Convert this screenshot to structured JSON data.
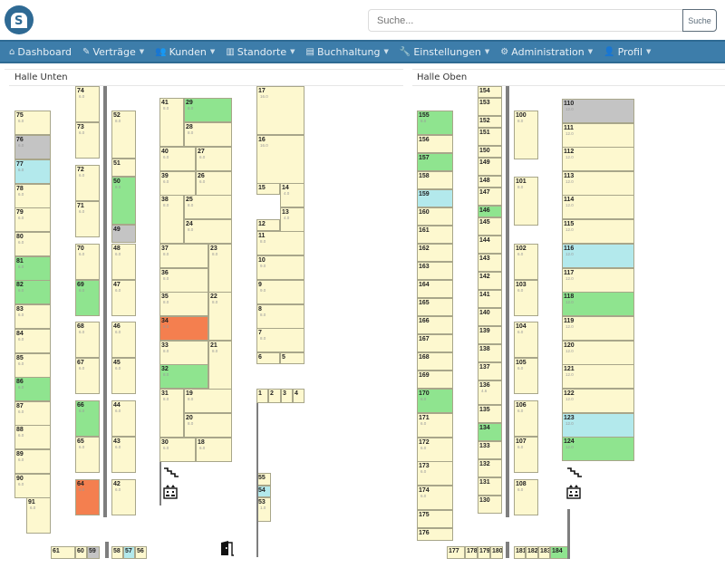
{
  "header": {
    "logo": "storage-logo",
    "search": {
      "placeholder": "Suche...",
      "value": "",
      "button": "Suche"
    }
  },
  "nav": [
    {
      "label": "Dashboard",
      "icon": "home-icon",
      "glyph": "⌂",
      "dropdown": false
    },
    {
      "label": "Verträge",
      "icon": "contract-icon",
      "glyph": "✎",
      "dropdown": true
    },
    {
      "label": "Kunden",
      "icon": "users-icon",
      "glyph": "👥",
      "dropdown": true
    },
    {
      "label": "Standorte",
      "icon": "warehouse-icon",
      "glyph": "▥",
      "dropdown": true
    },
    {
      "label": "Buchhaltung",
      "icon": "document-icon",
      "glyph": "▤",
      "dropdown": true
    },
    {
      "label": "Einstellungen",
      "icon": "wrench-icon",
      "glyph": "🔧",
      "dropdown": true
    },
    {
      "label": "Administration",
      "icon": "gear-icon",
      "glyph": "⚙",
      "dropdown": true
    },
    {
      "label": "Profil",
      "icon": "user-icon",
      "glyph": "👤",
      "dropdown": true
    }
  ],
  "halls": [
    {
      "title": "Halle Unten",
      "units": [
        {
          "id": "74",
          "size": "6.0",
          "status": "free"
        },
        {
          "id": "73",
          "size": "6.0",
          "status": "free"
        },
        {
          "id": "75",
          "size": "6.0",
          "status": "free"
        },
        {
          "id": "76",
          "size": "6.0",
          "status": "blocked"
        },
        {
          "id": "77",
          "size": "6.0",
          "status": "reserved"
        },
        {
          "id": "78",
          "size": "6.0",
          "status": "free"
        },
        {
          "id": "79",
          "size": "6.0",
          "status": "free"
        },
        {
          "id": "80",
          "size": "6.0",
          "status": "free"
        },
        {
          "id": "81",
          "size": "6.0",
          "status": "rented"
        },
        {
          "id": "82",
          "size": "6.0",
          "status": "rented"
        },
        {
          "id": "83",
          "size": "6.0",
          "status": "free"
        },
        {
          "id": "84",
          "size": "6.0",
          "status": "free"
        },
        {
          "id": "85",
          "size": "6.0",
          "status": "free"
        },
        {
          "id": "86",
          "size": "6.0",
          "status": "rented"
        },
        {
          "id": "87",
          "size": "6.0",
          "status": "free"
        },
        {
          "id": "88",
          "size": "6.0",
          "status": "free"
        },
        {
          "id": "89",
          "size": "6.0",
          "status": "free"
        },
        {
          "id": "90",
          "size": "6.0",
          "status": "free"
        },
        {
          "id": "91",
          "size": "6.0",
          "status": "free"
        },
        {
          "id": "72",
          "size": "6.0",
          "status": "free"
        },
        {
          "id": "71",
          "size": "6.0",
          "status": "free"
        },
        {
          "id": "70",
          "size": "6.0",
          "status": "free"
        },
        {
          "id": "69",
          "size": "6.0",
          "status": "rented"
        },
        {
          "id": "68",
          "size": "6.0",
          "status": "free"
        },
        {
          "id": "67",
          "size": "6.0",
          "status": "free"
        },
        {
          "id": "66",
          "size": "6.0",
          "status": "rented"
        },
        {
          "id": "65",
          "size": "6.0",
          "status": "free"
        },
        {
          "id": "64",
          "size": "6.0",
          "status": "overdue"
        },
        {
          "id": "52",
          "size": "8.0",
          "status": "free"
        },
        {
          "id": "51",
          "size": "",
          "status": "free"
        },
        {
          "id": "50",
          "size": "8.0",
          "status": "rented"
        },
        {
          "id": "49",
          "size": "",
          "status": "blocked"
        },
        {
          "id": "48",
          "size": "6.0",
          "status": "free"
        },
        {
          "id": "47",
          "size": "6.0",
          "status": "free"
        },
        {
          "id": "46",
          "size": "6.0",
          "status": "free"
        },
        {
          "id": "45",
          "size": "6.0",
          "status": "free"
        },
        {
          "id": "44",
          "size": "6.0",
          "status": "free"
        },
        {
          "id": "43",
          "size": "6.0",
          "status": "free"
        },
        {
          "id": "42",
          "size": "6.0",
          "status": "free"
        },
        {
          "id": "41",
          "size": "8.0",
          "status": "free"
        },
        {
          "id": "29",
          "size": "8.0",
          "status": "rented"
        },
        {
          "id": "28",
          "size": "8.0",
          "status": "free"
        },
        {
          "id": "40",
          "size": "6.0",
          "status": "free"
        },
        {
          "id": "27",
          "size": "6.0",
          "status": "free"
        },
        {
          "id": "39",
          "size": "6.0",
          "status": "free"
        },
        {
          "id": "26",
          "size": "6.0",
          "status": "free"
        },
        {
          "id": "38",
          "size": "8.0",
          "status": "free"
        },
        {
          "id": "25",
          "size": "8.0",
          "status": "free"
        },
        {
          "id": "24",
          "size": "8.0",
          "status": "free"
        },
        {
          "id": "37",
          "size": "8.0",
          "status": "free"
        },
        {
          "id": "23",
          "size": "8.0",
          "status": "free"
        },
        {
          "id": "36",
          "size": "8.0",
          "status": "free"
        },
        {
          "id": "35",
          "size": "8.0",
          "status": "free"
        },
        {
          "id": "22",
          "size": "8.0",
          "status": "free"
        },
        {
          "id": "34",
          "size": "8.0",
          "status": "overdue"
        },
        {
          "id": "33",
          "size": "8.0",
          "status": "free"
        },
        {
          "id": "21",
          "size": "8.0",
          "status": "free"
        },
        {
          "id": "32",
          "size": "8.0",
          "status": "rented"
        },
        {
          "id": "31",
          "size": "8.0",
          "status": "free"
        },
        {
          "id": "19",
          "size": "8.0",
          "status": "free"
        },
        {
          "id": "20",
          "size": "8.0",
          "status": "free"
        },
        {
          "id": "30",
          "size": "6.0",
          "status": "free"
        },
        {
          "id": "18",
          "size": "6.0",
          "status": "free"
        },
        {
          "id": "17",
          "size": "16.0",
          "status": "free"
        },
        {
          "id": "16",
          "size": "16.0",
          "status": "free"
        },
        {
          "id": "15",
          "size": "",
          "status": "free"
        },
        {
          "id": "14",
          "size": "4.0",
          "status": "free"
        },
        {
          "id": "13",
          "size": "4.0",
          "status": "free"
        },
        {
          "id": "12",
          "size": "",
          "status": "free"
        },
        {
          "id": "11",
          "size": "8.0",
          "status": "free"
        },
        {
          "id": "10",
          "size": "9.0",
          "status": "free"
        },
        {
          "id": "9",
          "size": "9.0",
          "status": "free"
        },
        {
          "id": "8",
          "size": "8.0",
          "status": "free"
        },
        {
          "id": "7",
          "size": "8.0",
          "status": "free"
        },
        {
          "id": "6",
          "size": "",
          "status": "free"
        },
        {
          "id": "5",
          "size": "",
          "status": "free"
        },
        {
          "id": "1",
          "size": "",
          "status": "free"
        },
        {
          "id": "2",
          "size": "",
          "status": "free"
        },
        {
          "id": "3",
          "size": "",
          "status": "free"
        },
        {
          "id": "4",
          "size": "",
          "status": "free"
        },
        {
          "id": "55",
          "size": "",
          "status": "free"
        },
        {
          "id": "54",
          "size": "",
          "status": "reserved"
        },
        {
          "id": "53",
          "size": "1.0",
          "status": "free"
        },
        {
          "id": "61",
          "size": "",
          "status": "free"
        },
        {
          "id": "60",
          "size": "",
          "status": "free"
        },
        {
          "id": "59",
          "size": "",
          "status": "blocked"
        },
        {
          "id": "58",
          "size": "",
          "status": "free"
        },
        {
          "id": "57",
          "size": "",
          "status": "reserved"
        },
        {
          "id": "56",
          "size": "",
          "status": "free"
        }
      ]
    },
    {
      "title": "Halle Oben",
      "units": [
        {
          "id": "155",
          "size": "6.0",
          "status": "rented"
        },
        {
          "id": "156",
          "size": "",
          "status": "free"
        },
        {
          "id": "157",
          "size": "",
          "status": "rented"
        },
        {
          "id": "158",
          "size": "",
          "status": "free"
        },
        {
          "id": "159",
          "size": "",
          "status": "reserved"
        },
        {
          "id": "160",
          "size": "",
          "status": "free"
        },
        {
          "id": "161",
          "size": "",
          "status": "free"
        },
        {
          "id": "162",
          "size": "",
          "status": "free"
        },
        {
          "id": "163",
          "size": "",
          "status": "free"
        },
        {
          "id": "164",
          "size": "",
          "status": "free"
        },
        {
          "id": "165",
          "size": "",
          "status": "free"
        },
        {
          "id": "166",
          "size": "",
          "status": "free"
        },
        {
          "id": "167",
          "size": "",
          "status": "free"
        },
        {
          "id": "168",
          "size": "",
          "status": "free"
        },
        {
          "id": "169",
          "size": "",
          "status": "free"
        },
        {
          "id": "170",
          "size": "6.0",
          "status": "rented"
        },
        {
          "id": "171",
          "size": "6.0",
          "status": "free"
        },
        {
          "id": "172",
          "size": "6.0",
          "status": "free"
        },
        {
          "id": "173",
          "size": "6.0",
          "status": "free"
        },
        {
          "id": "174",
          "size": "6.0",
          "status": "free"
        },
        {
          "id": "175",
          "size": "",
          "status": "free"
        },
        {
          "id": "176",
          "size": "",
          "status": "free"
        },
        {
          "id": "154",
          "size": "",
          "status": "free"
        },
        {
          "id": "153",
          "size": "",
          "status": "free"
        },
        {
          "id": "152",
          "size": "",
          "status": "free"
        },
        {
          "id": "151",
          "size": "",
          "status": "free"
        },
        {
          "id": "150",
          "size": "",
          "status": "free"
        },
        {
          "id": "149",
          "size": "",
          "status": "free"
        },
        {
          "id": "148",
          "size": "",
          "status": "free"
        },
        {
          "id": "147",
          "size": "",
          "status": "free"
        },
        {
          "id": "146",
          "size": "",
          "status": "rented"
        },
        {
          "id": "145",
          "size": "",
          "status": "free"
        },
        {
          "id": "144",
          "size": "",
          "status": "free"
        },
        {
          "id": "143",
          "size": "",
          "status": "free"
        },
        {
          "id": "142",
          "size": "",
          "status": "free"
        },
        {
          "id": "141",
          "size": "",
          "status": "free"
        },
        {
          "id": "140",
          "size": "",
          "status": "free"
        },
        {
          "id": "139",
          "size": "",
          "status": "free"
        },
        {
          "id": "138",
          "size": "",
          "status": "free"
        },
        {
          "id": "137",
          "size": "",
          "status": "free"
        },
        {
          "id": "136",
          "size": "4.6",
          "status": "free"
        },
        {
          "id": "135",
          "size": "",
          "status": "free"
        },
        {
          "id": "134",
          "size": "",
          "status": "rented"
        },
        {
          "id": "133",
          "size": "",
          "status": "free"
        },
        {
          "id": "132",
          "size": "",
          "status": "free"
        },
        {
          "id": "131",
          "size": "",
          "status": "free"
        },
        {
          "id": "130",
          "size": "",
          "status": "free"
        },
        {
          "id": "100",
          "size": "8.0",
          "status": "free"
        },
        {
          "id": "101",
          "size": "8.0",
          "status": "free"
        },
        {
          "id": "102",
          "size": "6.0",
          "status": "free"
        },
        {
          "id": "103",
          "size": "6.0",
          "status": "free"
        },
        {
          "id": "104",
          "size": "6.0",
          "status": "free"
        },
        {
          "id": "105",
          "size": "6.0",
          "status": "free"
        },
        {
          "id": "106",
          "size": "6.0",
          "status": "free"
        },
        {
          "id": "107",
          "size": "6.0",
          "status": "free"
        },
        {
          "id": "108",
          "size": "6.0",
          "status": "free"
        },
        {
          "id": "110",
          "size": "12.0",
          "status": "blocked"
        },
        {
          "id": "111",
          "size": "12.0",
          "status": "free"
        },
        {
          "id": "112",
          "size": "12.0",
          "status": "free"
        },
        {
          "id": "113",
          "size": "12.0",
          "status": "free"
        },
        {
          "id": "114",
          "size": "12.0",
          "status": "free"
        },
        {
          "id": "115",
          "size": "12.0",
          "status": "free"
        },
        {
          "id": "116",
          "size": "12.0",
          "status": "reserved"
        },
        {
          "id": "117",
          "size": "12.0",
          "status": "free"
        },
        {
          "id": "118",
          "size": "12.0",
          "status": "rented"
        },
        {
          "id": "119",
          "size": "12.0",
          "status": "free"
        },
        {
          "id": "120",
          "size": "12.0",
          "status": "free"
        },
        {
          "id": "121",
          "size": "12.0",
          "status": "free"
        },
        {
          "id": "122",
          "size": "12.0",
          "status": "free"
        },
        {
          "id": "123",
          "size": "12.0",
          "status": "reserved"
        },
        {
          "id": "124",
          "size": "12.0",
          "status": "rented"
        },
        {
          "id": "177",
          "size": "",
          "status": "free"
        },
        {
          "id": "178",
          "size": "",
          "status": "free"
        },
        {
          "id": "179",
          "size": "",
          "status": "free"
        },
        {
          "id": "180",
          "size": "",
          "status": "free"
        },
        {
          "id": "181",
          "size": "",
          "status": "free"
        },
        {
          "id": "182",
          "size": "",
          "status": "free"
        },
        {
          "id": "183",
          "size": "",
          "status": "free"
        },
        {
          "id": "184",
          "size": "",
          "status": "rented"
        }
      ]
    }
  ],
  "status_colors": {
    "free": "#fdf8cf",
    "rented": "#8fe48f",
    "blocked": "#c4c4c4",
    "reserved": "#b3e9ec",
    "overdue": "#f47f4f"
  },
  "symbols": {
    "stairs": "stairs-icon",
    "elevator": "elevator-icon",
    "door": "door-icon"
  }
}
